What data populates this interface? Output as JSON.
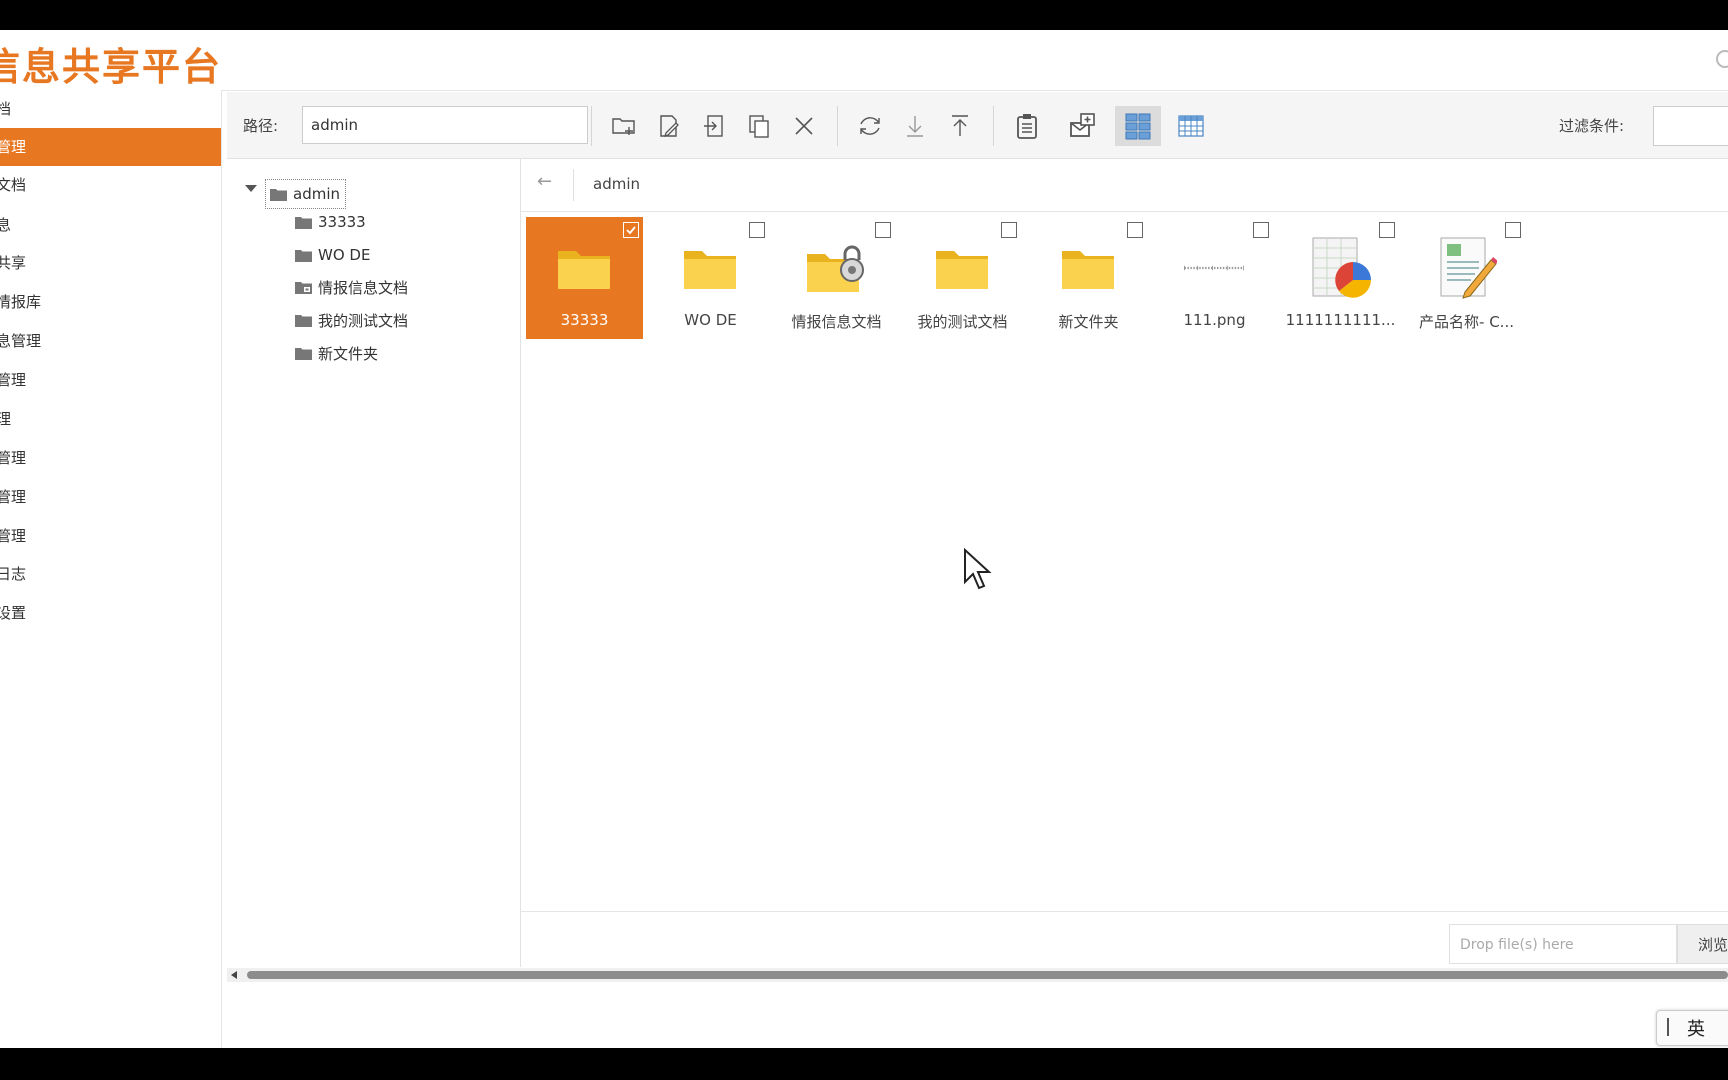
{
  "app": {
    "title": "信息共享平台"
  },
  "sidebar": {
    "items": [
      {
        "label": "档",
        "active": false
      },
      {
        "label": "管理",
        "active": true
      },
      {
        "label": "文档",
        "active": false
      },
      {
        "label": "息",
        "active": false
      },
      {
        "label": "共享",
        "active": false
      },
      {
        "label": "情报库",
        "active": false
      },
      {
        "label": "息管理",
        "active": false
      },
      {
        "label": "管理",
        "active": false
      },
      {
        "label": "理",
        "active": false
      },
      {
        "label": "管理",
        "active": false
      },
      {
        "label": "管理",
        "active": false
      },
      {
        "label": "管理",
        "active": false
      },
      {
        "label": "日志",
        "active": false
      },
      {
        "label": "设置",
        "active": false
      }
    ]
  },
  "toolbar": {
    "path_label": "路径:",
    "path_value": "admin",
    "filter_label": "过滤条件:",
    "buttons": [
      "new-folder-icon",
      "rename-icon",
      "move-icon",
      "copy-icon",
      "delete-icon",
      "refresh-icon",
      "download-icon",
      "upload-icon",
      "clipboard-icon",
      "share-icon",
      "large-icons-view-icon",
      "list-view-icon"
    ]
  },
  "tree": {
    "root": "admin",
    "children": [
      {
        "label": "33333",
        "locked": false
      },
      {
        "label": "WO DE",
        "locked": false
      },
      {
        "label": "情报信息文档",
        "locked": true
      },
      {
        "label": "我的测试文档",
        "locked": false
      },
      {
        "label": "新文件夹",
        "locked": false
      }
    ]
  },
  "browser": {
    "back_symbol": "←",
    "breadcrumb": "admin",
    "files": [
      {
        "name": "33333",
        "kind": "folder",
        "selected": true
      },
      {
        "name": "WO DE",
        "kind": "folder",
        "selected": false
      },
      {
        "name": "情报信息文档",
        "kind": "locked-folder",
        "selected": false
      },
      {
        "name": "我的测试文档",
        "kind": "folder",
        "selected": false
      },
      {
        "name": "新文件夹",
        "kind": "folder",
        "selected": false
      },
      {
        "name": "111.png",
        "kind": "image",
        "selected": false
      },
      {
        "name": "1111111111...",
        "kind": "spreadsheet",
        "selected": false
      },
      {
        "name": "产品名称- C...",
        "kind": "document",
        "selected": false
      }
    ]
  },
  "upload": {
    "drop_placeholder": "Drop file(s) here",
    "browse_label": "浏览"
  },
  "ime": {
    "lang": "英"
  },
  "colors": {
    "accent": "#e87722",
    "folder": "#f5c73a"
  }
}
